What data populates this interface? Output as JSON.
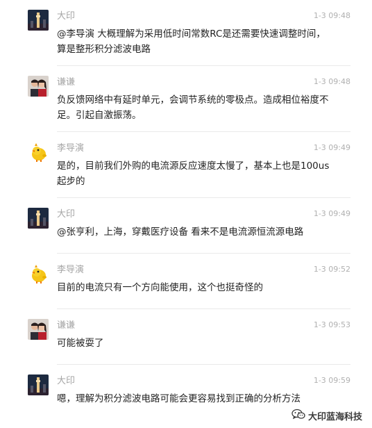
{
  "messages": [
    {
      "sender": "大印",
      "avatar": "night-tower-avatar",
      "time": "1-3 09:48",
      "text": "@李导演 大概理解为采用低时间常数RC是还需要快速调整时间，算是整形积分滤波电路"
    },
    {
      "sender": "谦谦",
      "avatar": "couple-photo-avatar",
      "time": "1-3 09:48",
      "text": "负反馈网络中有延时单元，会调节系统的零极点。造成相位裕度不足。引起自激振荡。"
    },
    {
      "sender": "李导演",
      "avatar": "yellow-chick-avatar",
      "time": "1-3 09:49",
      "text": "是的，目前我们外购的电流源反应速度太慢了，基本上也是100us起步的"
    },
    {
      "sender": "大印",
      "avatar": "night-tower-avatar",
      "time": "1-3 09:49",
      "text": "@张亨利，上海，穿戴医疗设备 看来不是电流源恒流源电路"
    },
    {
      "sender": "李导演",
      "avatar": "yellow-chick-avatar",
      "time": "1-3 09:52",
      "text": "目前的电流只有一个方向能使用，这个也挺奇怪的"
    },
    {
      "sender": "谦谦",
      "avatar": "couple-photo-avatar",
      "time": "1-3 09:53",
      "text": "可能被耍了"
    },
    {
      "sender": "大印",
      "avatar": "night-tower-avatar",
      "time": "1-3 09:59",
      "text": "嗯，理解为积分滤波电路可能会更容易找到正确的分析方法"
    }
  ],
  "watermark": {
    "icon": "wechat-icon",
    "text": "大印蓝海科技"
  }
}
